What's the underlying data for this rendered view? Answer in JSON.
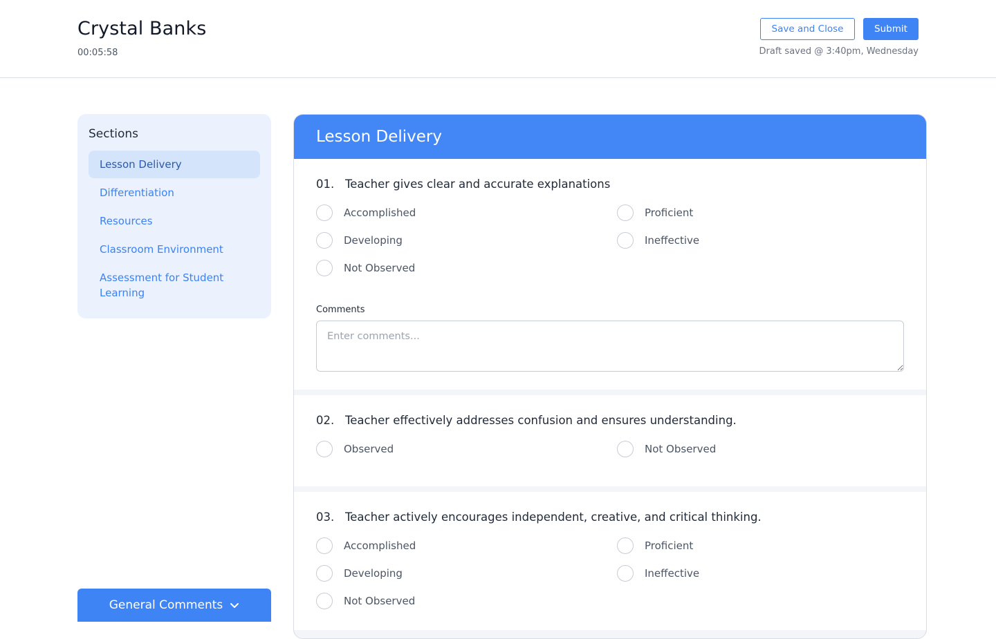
{
  "header": {
    "name": "Crystal Banks",
    "timer": "00:05:58",
    "save_label": "Save and Close",
    "submit_label": "Submit",
    "draft_status": "Draft saved @ 3:40pm, Wednesday"
  },
  "sidebar": {
    "title": "Sections",
    "items": [
      {
        "label": "Lesson Delivery",
        "active": true
      },
      {
        "label": "Differentiation"
      },
      {
        "label": "Resources"
      },
      {
        "label": "Classroom Environment"
      },
      {
        "label": "Assessment for Student Learning"
      }
    ],
    "general_comments_label": "General Comments",
    "general_comments_icon": "chevron-down-icon"
  },
  "section": {
    "title": "Lesson Delivery",
    "questions": [
      {
        "number": "01.",
        "text": "Teacher gives clear and accurate explanations",
        "options": [
          "Accomplished",
          "Proficient",
          "Developing",
          "Ineffective",
          "Not Observed"
        ],
        "comments_label": "Comments",
        "comments_placeholder": "Enter comments..."
      },
      {
        "number": "02.",
        "text": "Teacher effectively addresses confusion and ensures understanding.",
        "options": [
          "Observed",
          "Not Observed"
        ]
      },
      {
        "number": "03.",
        "text": "Teacher actively encourages independent, creative, and critical thinking.",
        "options": [
          "Accomplished",
          "Proficient",
          "Developing",
          "Ineffective",
          "Not Observed"
        ]
      }
    ]
  },
  "colors": {
    "accent": "#3f84f4",
    "sidebar_bg": "#ebf2fd",
    "active_item_bg": "#d4e4fb"
  }
}
